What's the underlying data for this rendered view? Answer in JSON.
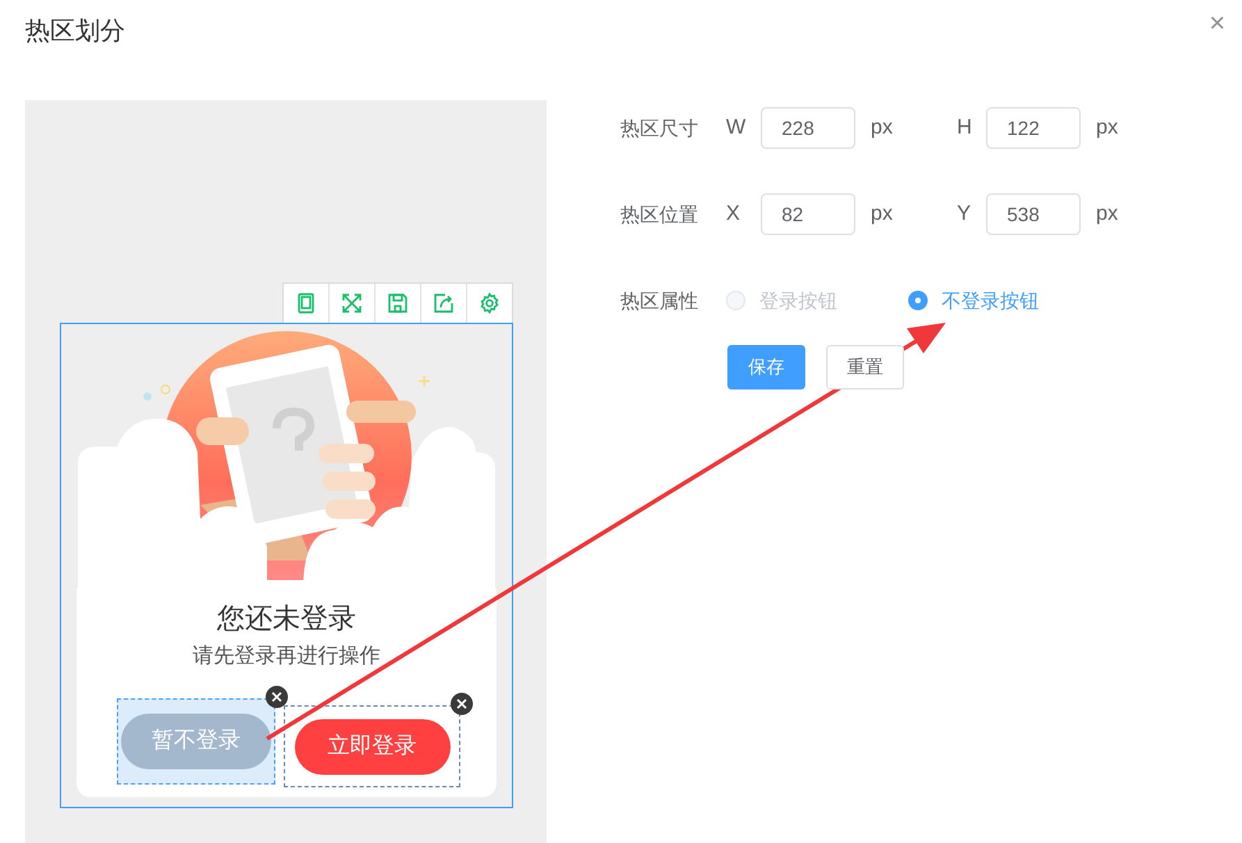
{
  "dialog": {
    "title": "热区划分",
    "close": "×"
  },
  "preview": {
    "toolbar": [
      {
        "kind": "tablet"
      },
      {
        "kind": "expand"
      },
      {
        "kind": "save"
      },
      {
        "kind": "share"
      },
      {
        "kind": "settings"
      }
    ],
    "heading": "您还未登录",
    "subheading": "请先登录再进行操作",
    "hotspots": [
      {
        "label": "暂不登录",
        "kind": "secondary",
        "selected": true
      },
      {
        "label": "立即登录",
        "kind": "primary",
        "selected": false
      }
    ]
  },
  "form": {
    "rows": [
      {
        "label": "热区尺寸",
        "fields": [
          {
            "axis": "W",
            "value": "228",
            "unit": "px"
          },
          {
            "axis": "H",
            "value": "122",
            "unit": "px"
          }
        ]
      },
      {
        "label": "热区位置",
        "fields": [
          {
            "axis": "X",
            "value": "82",
            "unit": "px"
          },
          {
            "axis": "Y",
            "value": "538",
            "unit": "px"
          }
        ]
      }
    ],
    "property": {
      "label": "热区属性",
      "options": [
        {
          "label": "登录按钮",
          "selected": false,
          "disabled": true
        },
        {
          "label": "不登录按钮",
          "selected": true,
          "disabled": false
        }
      ]
    },
    "buttons": [
      {
        "label": "保存",
        "kind": "primary"
      },
      {
        "label": "重置",
        "kind": "default"
      }
    ]
  }
}
